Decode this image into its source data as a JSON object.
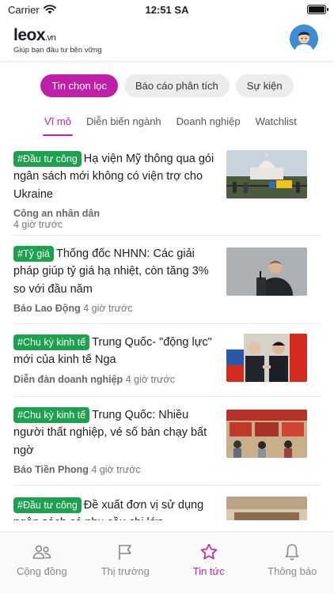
{
  "status_bar": {
    "carrier": "Carrier",
    "time": "12:51 SA",
    "battery_level": 1.0
  },
  "header": {
    "logo_text": "leox",
    "logo_suffix": ".vn",
    "tagline": "Giúp bạn đầu tư bền vững",
    "avatar_icon": "user-avatar-icon"
  },
  "segments": [
    {
      "label": "Tin chọn lọc",
      "active": true
    },
    {
      "label": "Báo cáo phân tích",
      "active": false
    },
    {
      "label": "Sự kiện",
      "active": false
    }
  ],
  "subtabs": [
    {
      "label": "Vĩ mô",
      "active": true
    },
    {
      "label": "Diễn biến ngành",
      "active": false
    },
    {
      "label": "Doanh nghiệp",
      "active": false
    },
    {
      "label": "Watchlist",
      "active": false
    }
  ],
  "articles": [
    {
      "tag": "#Đầu tư công",
      "title": "Hạ viện Mỹ thông qua gói ngân sách mới không có viện trợ cho Ukraine",
      "source": "Công an nhân dân",
      "time": " 4 giờ trước"
    },
    {
      "tag": "#Tỷ giá",
      "title": "Thống đốc NHNN: Các giải pháp giúp tỷ giá hạ nhiệt, còn tăng 3% so với đầu năm",
      "source": "Báo Lao Động",
      "time": "4 giờ trước"
    },
    {
      "tag": "#Chu kỳ kinh tế",
      "title": "Trung Quốc- \"động lực\" mới của kinh tế Nga",
      "source": "Diễn đàn doanh nghiệp",
      "time": "4 giờ trước"
    },
    {
      "tag": "#Chu kỳ kinh tế",
      "title": "Trung Quốc: Nhiều người thất nghiệp, vé số bán chạy bất ngờ",
      "source": "Báo Tiền Phong",
      "time": "4 giờ trước"
    },
    {
      "tag": "#Đầu tư công",
      "title": "Đề xuất đơn vị sử dụng ngân sách có nhu cầu chi lớn",
      "source": "",
      "time": ""
    }
  ],
  "bottom_nav": [
    {
      "label": "Cộng đồng",
      "icon": "community-icon",
      "active": false
    },
    {
      "label": "Thị trường",
      "icon": "flag-icon",
      "active": false
    },
    {
      "label": "Tin tức",
      "icon": "star-icon",
      "active": true
    },
    {
      "label": "Thông báo",
      "icon": "bell-icon",
      "active": false
    }
  ],
  "colors": {
    "accent": "#c020a8",
    "tag_green": "#1ca14f",
    "logo_blue": "#2e6bb6"
  }
}
